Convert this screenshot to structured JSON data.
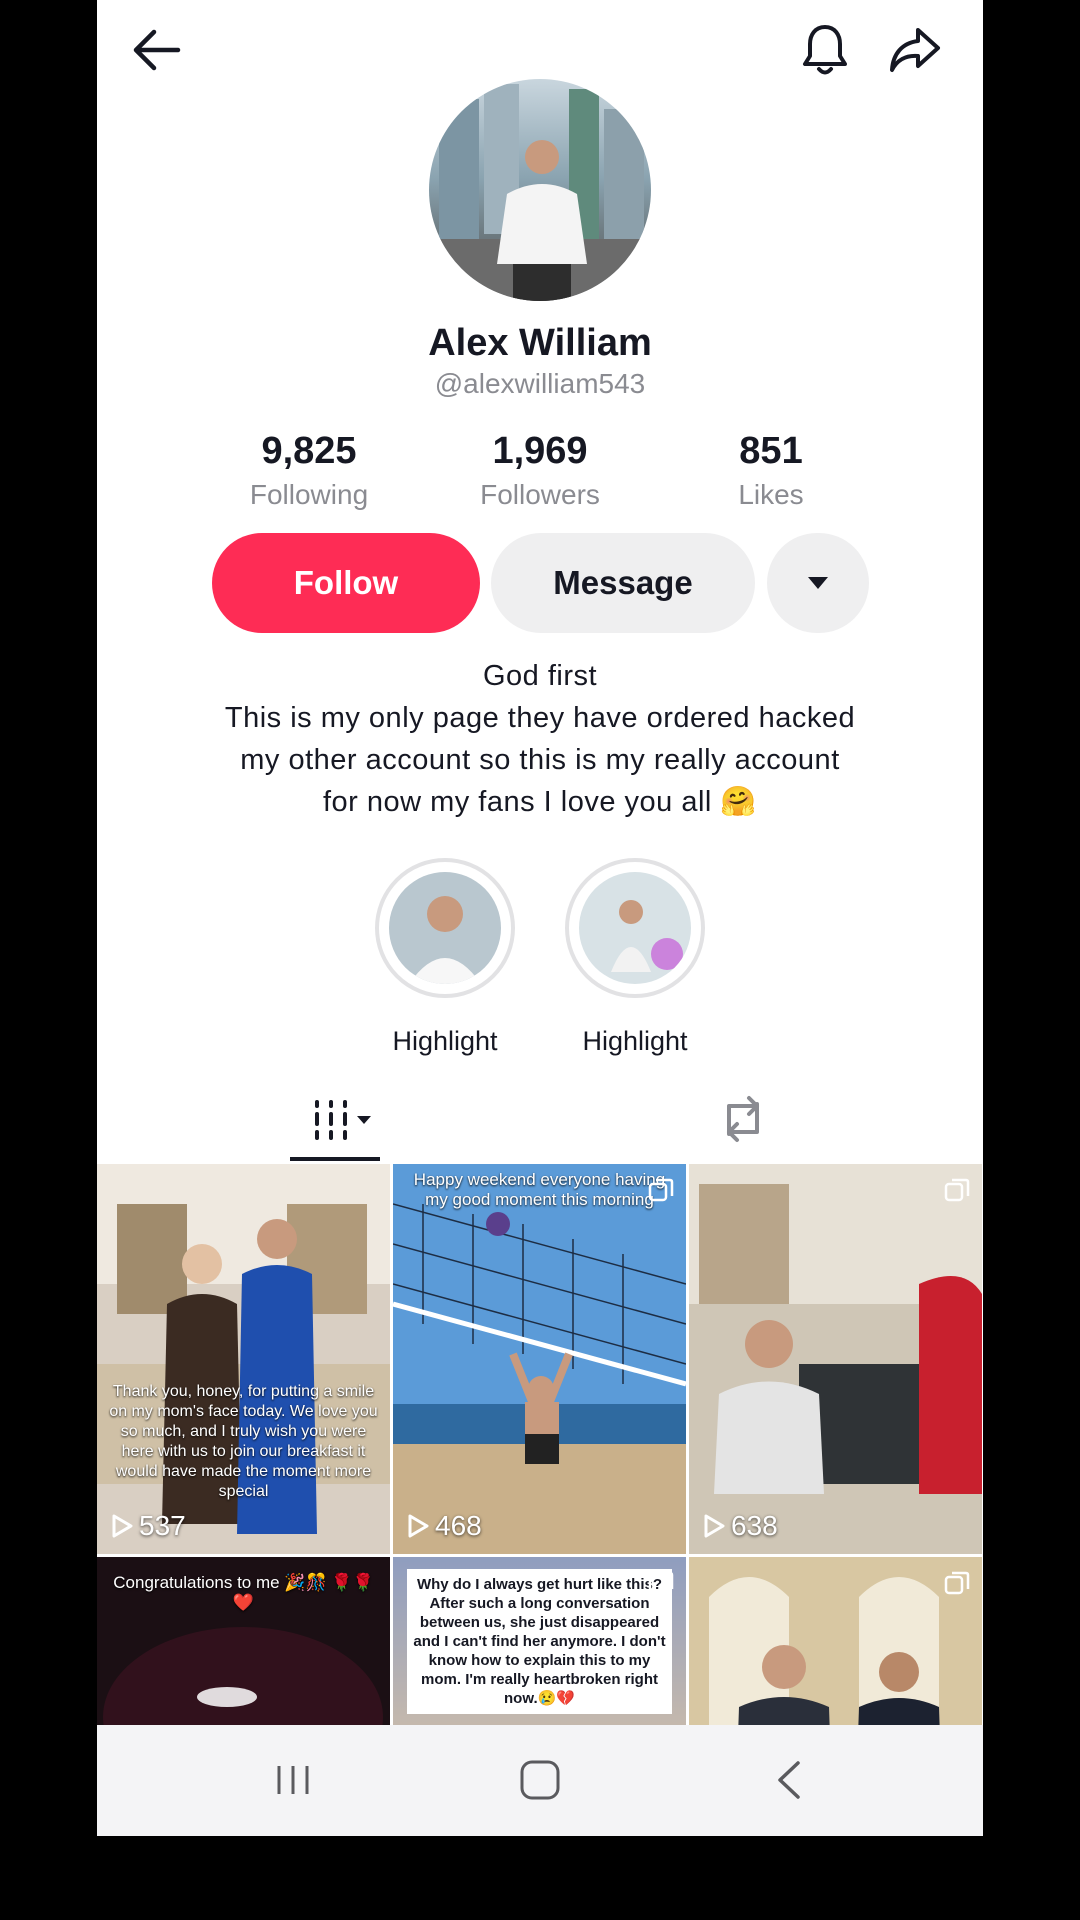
{
  "topbar": {
    "back_icon": "arrow-left-icon",
    "bell_icon": "bell-icon",
    "share_icon": "share-icon"
  },
  "profile": {
    "name": "Alex William",
    "handle": "@alexwilliam543"
  },
  "stats": [
    {
      "value": "9,825",
      "label": "Following"
    },
    {
      "value": "1,969",
      "label": "Followers"
    },
    {
      "value": "851",
      "label": "Likes"
    }
  ],
  "actions": {
    "follow": "Follow",
    "message": "Message",
    "more_icon": "caret-down-icon"
  },
  "colors": {
    "accent": "#fe2c55",
    "text": "#161823",
    "muted": "#8a8b91",
    "button_bg": "#efeff0"
  },
  "bio": {
    "line1": "God first",
    "line2": "This is my only page they have ordered hacked",
    "line3": "my other  account so this is my really account",
    "line4": "for now my fans I love you all 🤗"
  },
  "highlights": [
    {
      "label": "Highlight"
    },
    {
      "label": "Highlight"
    }
  ],
  "tabs": {
    "videos_icon": "grid-icon",
    "reposts_icon": "repost-icon"
  },
  "videos": [
    {
      "views": "537",
      "caption": "Thank you, honey, for putting a smile on my mom's face today. We love you so much, and I truly wish you were here with us to join our breakfast it would have made the moment more special"
    },
    {
      "views": "468",
      "caption": "Happy weekend everyone having my good moment this morning"
    },
    {
      "views": "638",
      "caption": ""
    },
    {
      "views": "",
      "caption": "Congratulations to me 🎉🎊 🌹🌹❤️"
    },
    {
      "views": "",
      "caption": "Why do I always get hurt like this? After such a long conversation between us, she just disappeared and I can't find her anymore. I don't know how to explain this to my mom. I'm really heartbroken right now.😢💔"
    },
    {
      "views": "",
      "caption": ""
    }
  ],
  "navbar": {
    "recent_icon": "recent-apps-icon",
    "home_icon": "home-icon",
    "back_icon": "nav-back-icon"
  }
}
